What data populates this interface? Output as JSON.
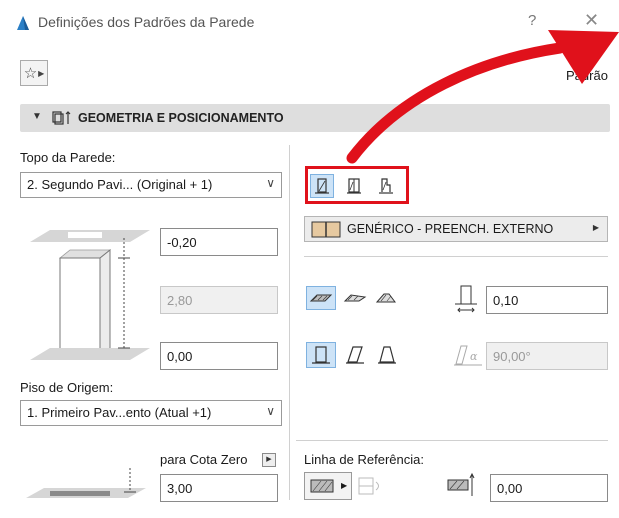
{
  "window": {
    "title": "Definições dos Padrões da Parede",
    "help_label": "?",
    "close_label": "✕"
  },
  "toolbar": {
    "favorites_icon": "star-icon",
    "default_label": "Padrão"
  },
  "section": {
    "title": "GEOMETRIA E POSICIONAMENTO",
    "expanded": true
  },
  "left": {
    "top_label": "Topo da Parede:",
    "top_select_value": "2. Segundo Pavi... (Original + 1)",
    "top_offset_value": "-0,20",
    "height_value": "2,80",
    "bottom_offset_value": "0,00",
    "origin_label": "Piso de Origem:",
    "origin_select_value": "1. Primeiro Pav...ento (Atual +1)",
    "zero_label": "para Cota Zero",
    "zero_value": "3,00"
  },
  "right": {
    "structure_options": [
      "basic-wall-icon",
      "composite-wall-icon",
      "profile-wall-icon"
    ],
    "structure_selected": 0,
    "fill_label": "GENÉRICO - PREENCH. EXTERNO",
    "geometry_options": [
      "straight-wall-icon",
      "trapezoid-wall-icon",
      "polygonal-wall-icon"
    ],
    "geometry_selected": 0,
    "thickness_value": "0,10",
    "profile_options": [
      "vertical-wall-icon",
      "slanted-wall-icon",
      "double-slanted-wall-icon"
    ],
    "profile_selected": 0,
    "angle_value": "90,00°",
    "reference_label": "Linha de Referência:",
    "reference_offset_value": "0,00"
  },
  "colors": {
    "highlight_red": "#e0111b",
    "selected_bg": "#cde3f7",
    "section_bg": "#dedede",
    "icon_blue": "#1f6fb5"
  }
}
